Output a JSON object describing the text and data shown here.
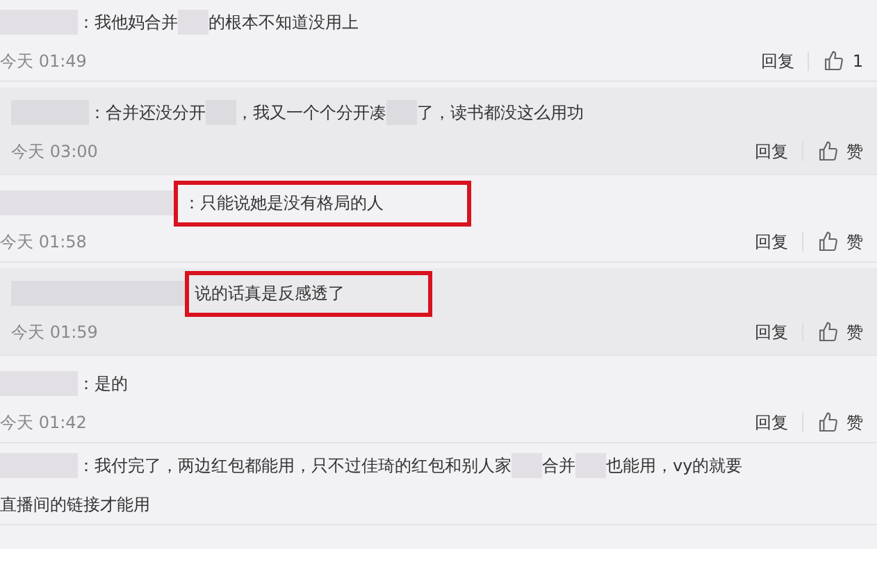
{
  "comments": [
    {
      "reply": false,
      "highlighted": false,
      "lines": [
        [
          {
            "kind": "blur"
          },
          {
            "kind": "text",
            "text": "：我他妈合并"
          },
          {
            "kind": "blur"
          },
          {
            "kind": "text",
            "text": "的根本不知道没用上"
          }
        ]
      ],
      "time": "今天 01:49",
      "reply_label": "回复",
      "like_label": "1"
    },
    {
      "reply": true,
      "highlighted": false,
      "lines": [
        [
          {
            "kind": "blur"
          },
          {
            "kind": "text",
            "text": "：合并还没分开"
          },
          {
            "kind": "blur"
          },
          {
            "kind": "text",
            "text": "，我又一个个分开凑"
          },
          {
            "kind": "blur"
          },
          {
            "kind": "text",
            "text": "了，读书都没这么用功"
          }
        ]
      ],
      "time": "今天 03:00",
      "reply_label": "回复",
      "like_label": "赞"
    },
    {
      "reply": false,
      "highlighted": true,
      "lines": [
        [
          {
            "kind": "blur"
          },
          {
            "kind": "text",
            "text": "：只能说她是没有格局的人"
          }
        ]
      ],
      "time": "今天 01:58",
      "reply_label": "回复",
      "like_label": "赞"
    },
    {
      "reply": true,
      "highlighted": true,
      "lines": [
        [
          {
            "kind": "blur"
          },
          {
            "kind": "text",
            "text": "说的话真是反感透了"
          }
        ]
      ],
      "time": "今天 01:59",
      "reply_label": "回复",
      "like_label": "赞"
    },
    {
      "reply": false,
      "highlighted": false,
      "lines": [
        [
          {
            "kind": "blur"
          },
          {
            "kind": "text",
            "text": "：是的"
          }
        ]
      ],
      "time": "今天 01:42",
      "reply_label": "回复",
      "like_label": "赞"
    },
    {
      "reply": false,
      "highlighted": false,
      "lines": [
        [
          {
            "kind": "blur"
          },
          {
            "kind": "text",
            "text": "：我付完了，两边红包都能用，只不过佳琦的红包和别人家"
          },
          {
            "kind": "blur"
          },
          {
            "kind": "text",
            "text": "合并"
          },
          {
            "kind": "blur"
          },
          {
            "kind": "text",
            "text": "也能用，vy的就要"
          }
        ],
        [
          {
            "kind": "text",
            "text": "直播间的链接才能用"
          }
        ]
      ]
    }
  ]
}
